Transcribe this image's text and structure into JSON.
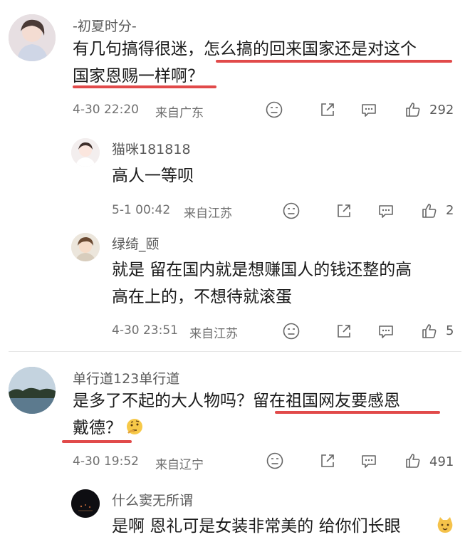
{
  "comments": [
    {
      "name": "-初夏时分-",
      "lines": [
        "有几句搞得很迷，怎么搞的回来国家还是对这个",
        "国家恩赐一样啊？"
      ],
      "time": "4-30 22:20",
      "location": "来自广东",
      "likes": "292"
    },
    {
      "name": "猫咪181818",
      "lines": [
        "高人一等呗"
      ],
      "time": "5-1 00:42",
      "location": "来自江苏",
      "likes": "2"
    },
    {
      "name": "绿绮_颐",
      "lines": [
        "就是 留在国内就是想赚国人的钱还整的高",
        "高在上的，不想待就滚蛋"
      ],
      "time": "4-30 23:51",
      "location": "来自江苏",
      "likes": "5"
    },
    {
      "name": "单行道123单行道",
      "lines": [
        "是多了不起的大人物吗？留在祖国网友要感恩",
        "戴德？"
      ],
      "time": "4-30 19:52",
      "location": "来自辽宁",
      "likes": "491"
    },
    {
      "name": "什么窦无所谓",
      "lines": [
        "是啊 恩礼可是女装非常美的 给你们长眼"
      ]
    }
  ],
  "colors": {
    "underline": "#e14a4a",
    "icon": "#666666"
  },
  "icons": [
    "dislike-icon",
    "share-icon",
    "comment-icon",
    "like-icon",
    "thinking-emoji",
    "cat-emoji"
  ]
}
